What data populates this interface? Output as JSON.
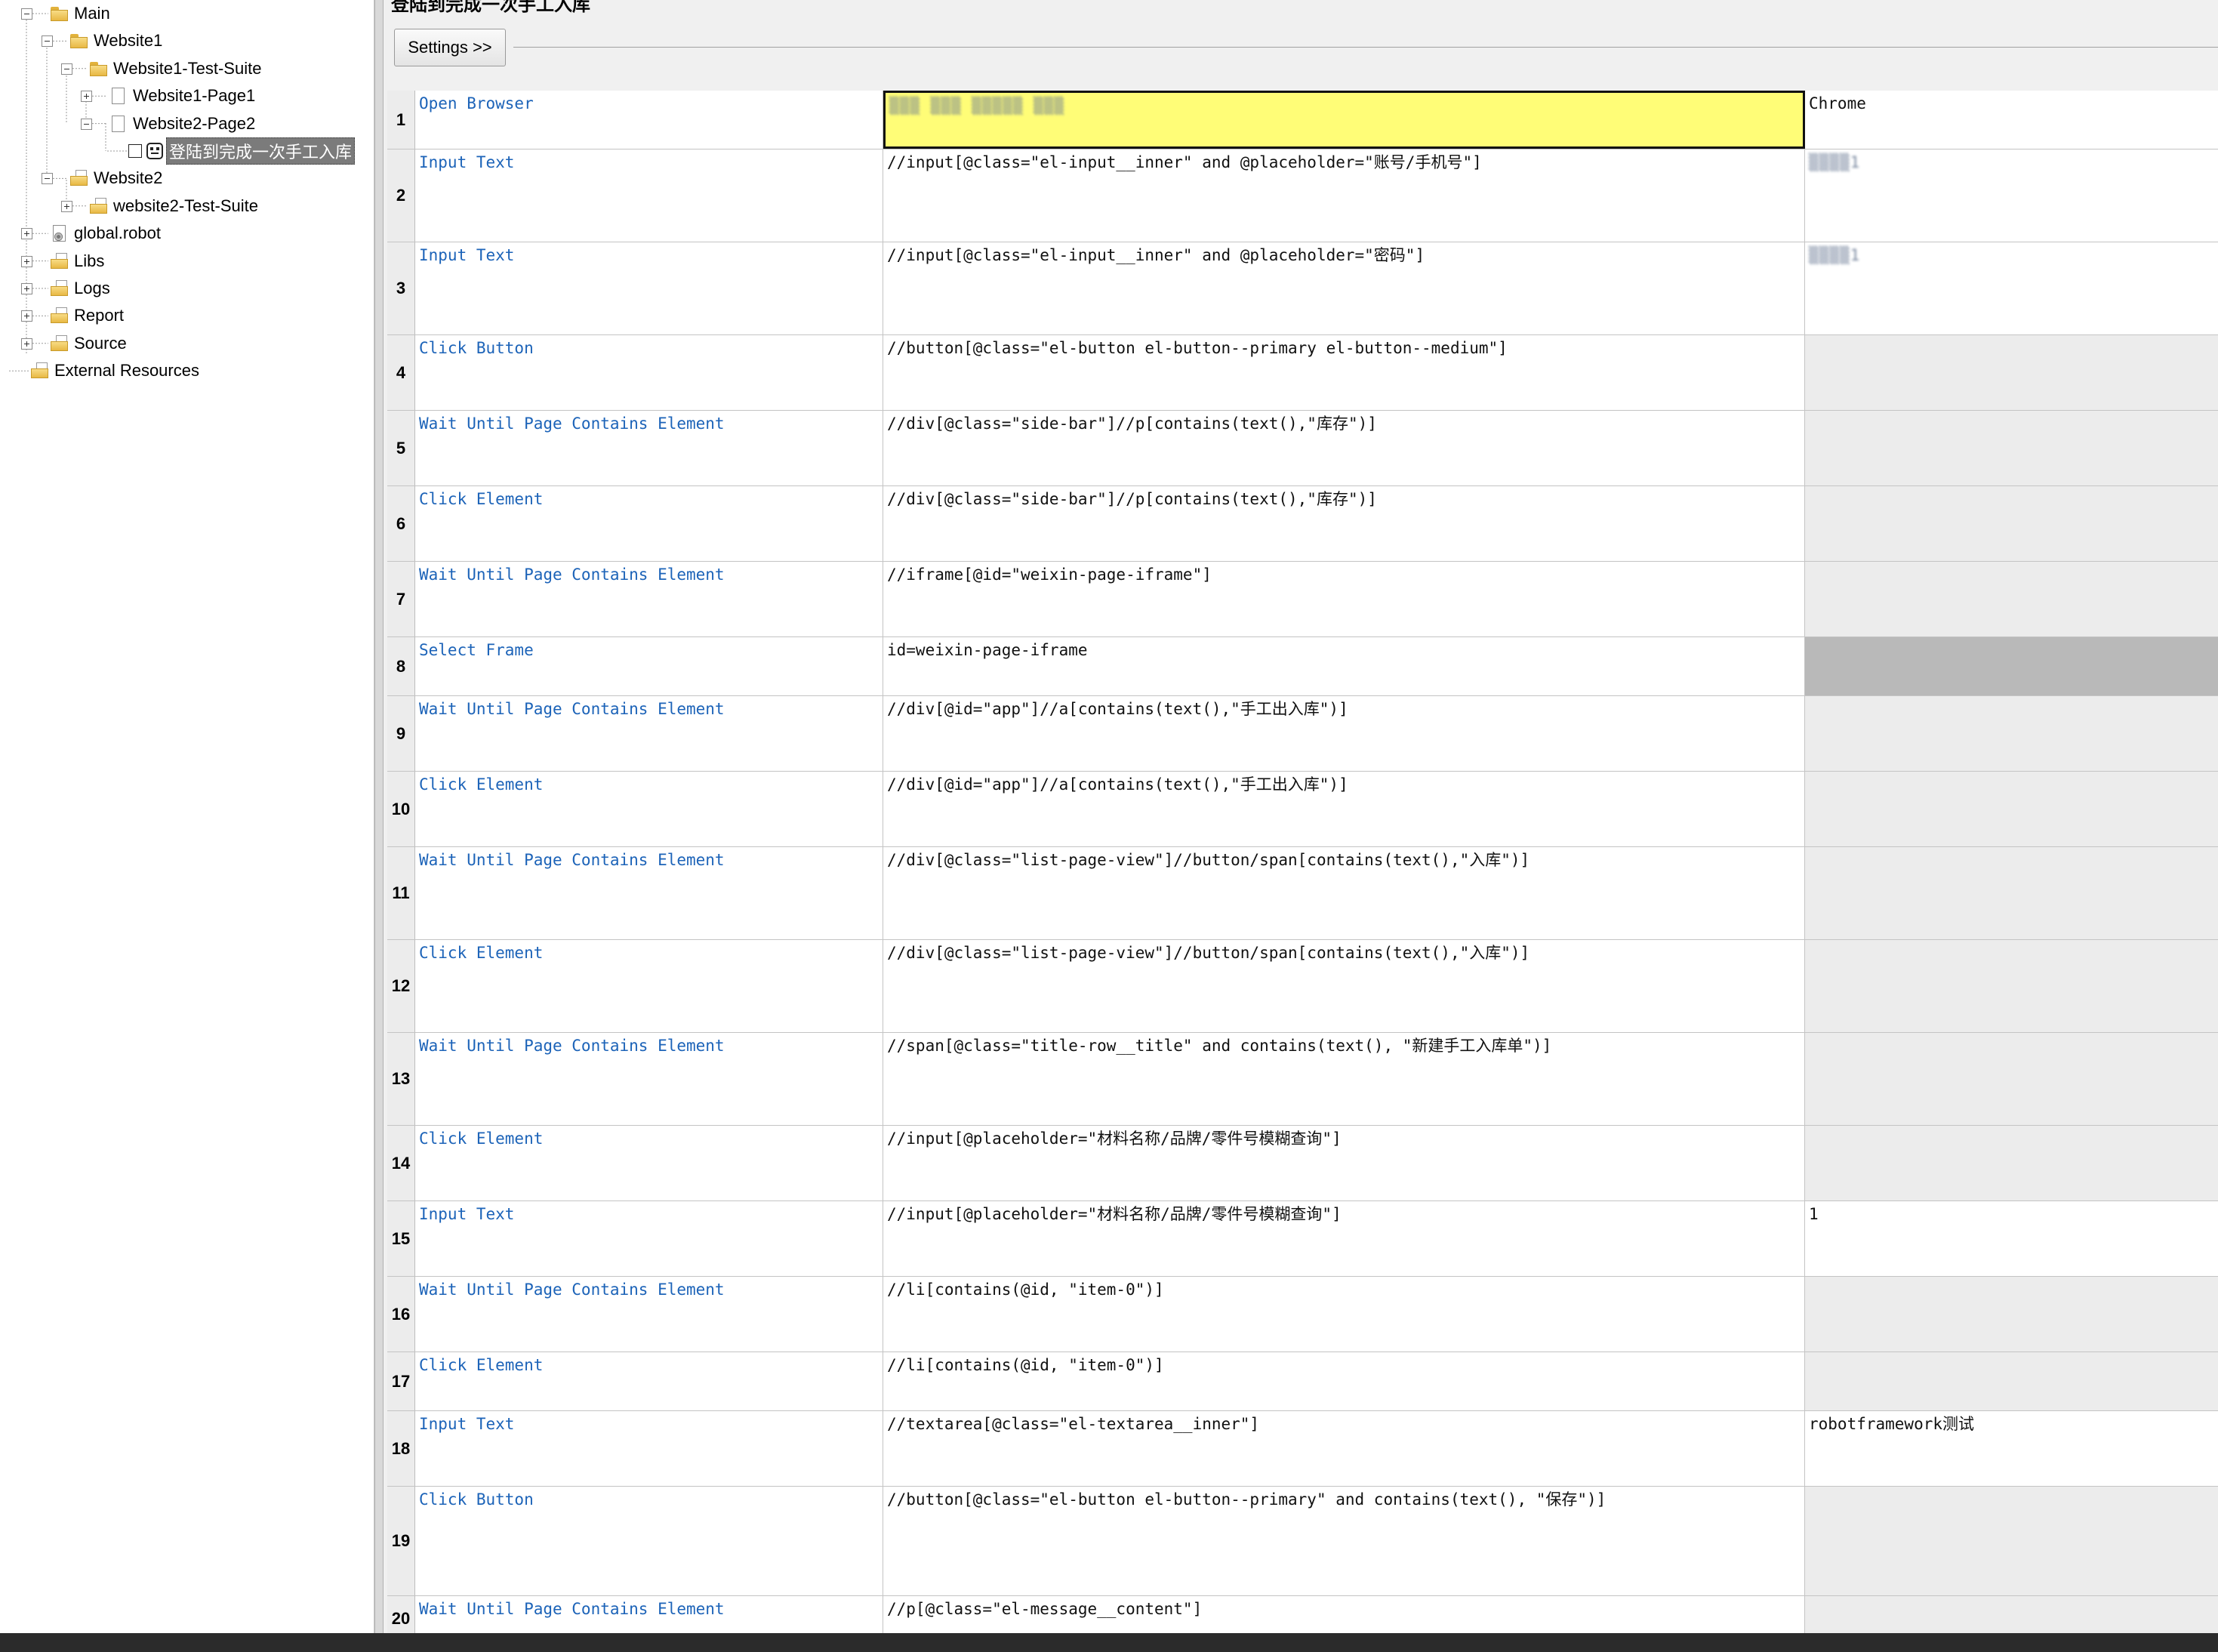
{
  "tree": {
    "items": [
      {
        "label": "Main",
        "icon": "folder-icon",
        "expander": "minus"
      },
      {
        "label": "Website1",
        "icon": "folder-icon",
        "expander": "minus"
      },
      {
        "label": "Website1-Test-Suite",
        "icon": "folder-icon",
        "expander": "minus"
      },
      {
        "label": "Website1-Page1",
        "icon": "file-icon",
        "expander": "plus"
      },
      {
        "label": "Website2-Page2",
        "icon": "file-icon",
        "expander": "minus"
      },
      {
        "label": "登陆到完成一次手工入库",
        "icon": "robot-icon",
        "expander": "none",
        "selected": true
      },
      {
        "label": "Website2",
        "icon": "folder-doc-icon",
        "expander": "minus"
      },
      {
        "label": "website2-Test-Suite",
        "icon": "folder-doc-icon",
        "expander": "plus"
      },
      {
        "label": "global.robot",
        "icon": "robot-file-icon",
        "expander": "plus"
      },
      {
        "label": "Libs",
        "icon": "folder-doc-icon",
        "expander": "plus"
      },
      {
        "label": "Logs",
        "icon": "folder-doc-icon",
        "expander": "plus"
      },
      {
        "label": "Report",
        "icon": "folder-doc-icon",
        "expander": "plus"
      },
      {
        "label": "Source",
        "icon": "folder-doc-icon",
        "expander": "plus"
      },
      {
        "label": "External Resources",
        "icon": "folder-doc-icon",
        "expander": "none"
      }
    ]
  },
  "editor": {
    "title": "登陆到完成一次手工入库",
    "settings_label": "Settings >>",
    "highlight_color": "#fffd77",
    "keyword_color": "#1c63b8"
  },
  "steps": [
    {
      "num": "1",
      "keyword": "Open Browser",
      "arg1": "",
      "arg1_redacted": "▒▒▒ ▒▒▒ ▒▒▒▒▒ ▒▒▒",
      "arg2": "Chrome",
      "arg2_bg": "white",
      "arg1_highlight": true
    },
    {
      "num": "2",
      "keyword": "Input Text",
      "arg1": "//input[@class=\"el-input__inner\" and @placeholder=\"账号/手机号\"]",
      "arg2": "",
      "arg2_redacted": "▒▒▒▒1",
      "arg2_bg": "white"
    },
    {
      "num": "3",
      "keyword": "Input Text",
      "arg1": "//input[@class=\"el-input__inner\" and @placeholder=\"密码\"]",
      "arg2": "",
      "arg2_redacted": "▒▒▒▒1",
      "arg2_bg": "white"
    },
    {
      "num": "4",
      "keyword": "Click Button",
      "arg1": "//button[@class=\"el-button el-button--primary el-button--medium\"]",
      "arg2": "",
      "arg2_bg": "gray"
    },
    {
      "num": "5",
      "keyword": "Wait Until Page Contains Element",
      "arg1": "//div[@class=\"side-bar\"]//p[contains(text(),\"库存\")]",
      "arg2": "",
      "arg2_bg": "gray"
    },
    {
      "num": "6",
      "keyword": "Click Element",
      "arg1": "//div[@class=\"side-bar\"]//p[contains(text(),\"库存\")]",
      "arg2": "",
      "arg2_bg": "gray"
    },
    {
      "num": "7",
      "keyword": "Wait Until Page Contains Element",
      "arg1": "//iframe[@id=\"weixin-page-iframe\"]",
      "arg2": "",
      "arg2_bg": "gray"
    },
    {
      "num": "8",
      "keyword": "Select Frame",
      "arg1": "id=weixin-page-iframe",
      "arg2": "",
      "arg2_bg": "dark"
    },
    {
      "num": "9",
      "keyword": "Wait Until Page Contains Element",
      "arg1": "//div[@id=\"app\"]//a[contains(text(),\"手工出入库\")]",
      "arg2": "",
      "arg2_bg": "gray"
    },
    {
      "num": "10",
      "keyword": "Click Element",
      "arg1": "//div[@id=\"app\"]//a[contains(text(),\"手工出入库\")]",
      "arg2": "",
      "arg2_bg": "gray"
    },
    {
      "num": "11",
      "keyword": "Wait Until Page Contains Element",
      "arg1": "//div[@class=\"list-page-view\"]//button/span[contains(text(),\"入库\")]",
      "arg2": "",
      "arg2_bg": "gray"
    },
    {
      "num": "12",
      "keyword": "Click Element",
      "arg1": "//div[@class=\"list-page-view\"]//button/span[contains(text(),\"入库\")]",
      "arg2": "",
      "arg2_bg": "gray"
    },
    {
      "num": "13",
      "keyword": "Wait Until Page Contains Element",
      "arg1": "//span[@class=\"title-row__title\" and contains(text(), \"新建手工入库单\")]",
      "arg2": "",
      "arg2_bg": "gray"
    },
    {
      "num": "14",
      "keyword": "Click Element",
      "arg1": "//input[@placeholder=\"材料名称/品牌/零件号模糊查询\"]",
      "arg2": "",
      "arg2_bg": "gray"
    },
    {
      "num": "15",
      "keyword": "Input Text",
      "arg1": "//input[@placeholder=\"材料名称/品牌/零件号模糊查询\"]",
      "arg2": "1",
      "arg2_bg": "white"
    },
    {
      "num": "16",
      "keyword": "Wait Until Page Contains Element",
      "arg1": "//li[contains(@id, \"item-0\")]",
      "arg2": "",
      "arg2_bg": "gray"
    },
    {
      "num": "17",
      "keyword": "Click Element",
      "arg1": "//li[contains(@id, \"item-0\")]",
      "arg2": "",
      "arg2_bg": "gray"
    },
    {
      "num": "18",
      "keyword": "Input Text",
      "arg1": "//textarea[@class=\"el-textarea__inner\"]",
      "arg2": "robotframework测试",
      "arg2_bg": "white"
    },
    {
      "num": "19",
      "keyword": "Click Button",
      "arg1": "//button[@class=\"el-button el-button--primary\" and contains(text(), \"保存\")]",
      "arg2": "",
      "arg2_bg": "gray"
    },
    {
      "num": "20",
      "keyword": "Wait Until Page Contains Element",
      "arg1": "//p[@class=\"el-message__content\"]",
      "arg2": "",
      "arg2_bg": "gray"
    }
  ]
}
